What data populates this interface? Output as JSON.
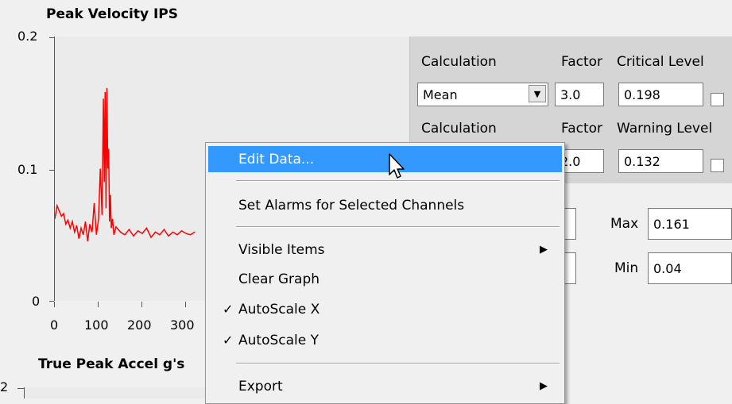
{
  "graph1": {
    "title": "Peak Velocity IPS",
    "y_ticks": [
      "0.2",
      "0.1",
      "0"
    ],
    "x_ticks": [
      "0",
      "100",
      "200",
      "300"
    ]
  },
  "alarm_panel": {
    "row1": {
      "calc_label": "Calculation",
      "factor_label": "Factor",
      "level_label": "Critical Level",
      "calc_value": "Mean",
      "factor_value": "3.0",
      "level_value": "0.198"
    },
    "row2": {
      "calc_label": "Calculation",
      "factor_label": "Factor",
      "level_label": "Warning Level",
      "factor_value": "2.0",
      "level_value": "0.132"
    },
    "stats": {
      "max_label": "Max",
      "max_value": "0.161",
      "min_label": "Min",
      "min_value": "0.04"
    }
  },
  "graph2": {
    "title": "True Peak Accel g's",
    "y_tick": "2"
  },
  "context_menu": {
    "items": [
      {
        "label": "Edit Data..."
      },
      {
        "label": "Set Alarms for Selected Channels"
      },
      {
        "label": "Visible Items"
      },
      {
        "label": "Clear Graph"
      },
      {
        "label": "AutoScale X"
      },
      {
        "label": "AutoScale Y"
      },
      {
        "label": "Export"
      }
    ],
    "check_glyph": "✓",
    "submenu_glyph": "▶"
  },
  "colors": {
    "trace": "#ff0000",
    "highlight": "#3399ff"
  },
  "chart_data": {
    "type": "line",
    "title": "Peak Velocity IPS",
    "xlabel": "",
    "ylabel": "",
    "ylim": [
      0,
      0.2
    ],
    "x_ticks": [
      0,
      100,
      200,
      300
    ],
    "series": [
      {
        "x": [
          0,
          5,
          10,
          15,
          20,
          25,
          30,
          35,
          40,
          45,
          50,
          55,
          60,
          65,
          70,
          75,
          80,
          85,
          90,
          95,
          100,
          104,
          108,
          111,
          113,
          115,
          117,
          119,
          121,
          123,
          125,
          127,
          129,
          132,
          135,
          140,
          150,
          160,
          170,
          180,
          190,
          200,
          210,
          220,
          230,
          240,
          250,
          260,
          270,
          280,
          290,
          300,
          310,
          320
        ],
        "y": [
          0.062,
          0.072,
          0.068,
          0.064,
          0.066,
          0.058,
          0.061,
          0.055,
          0.06,
          0.052,
          0.057,
          0.047,
          0.055,
          0.05,
          0.06,
          0.045,
          0.058,
          0.052,
          0.074,
          0.05,
          0.062,
          0.1,
          0.065,
          0.153,
          0.09,
          0.158,
          0.07,
          0.161,
          0.1,
          0.115,
          0.06,
          0.08,
          0.055,
          0.062,
          0.05,
          0.056,
          0.052,
          0.05,
          0.054,
          0.049,
          0.053,
          0.051,
          0.055,
          0.048,
          0.052,
          0.05,
          0.054,
          0.049,
          0.052,
          0.05,
          0.053,
          0.051,
          0.05,
          0.052
        ]
      }
    ]
  }
}
